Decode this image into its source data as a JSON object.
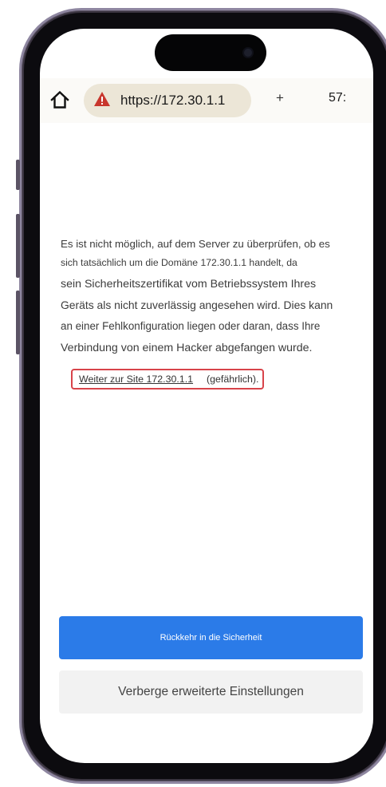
{
  "browser": {
    "url": "https://172.30.1.1",
    "new_tab_label": "+",
    "clock": "57:"
  },
  "warning": {
    "lines": [
      "Es ist nicht möglich, auf dem Server zu überprüfen, ob es",
      "sich tatsächlich um die Domäne 172.30.1.1 handelt, da",
      "sein Sicherheitszertifikat vom Betriebssystem Ihres",
      "Geräts als nicht zuverlässig angesehen wird. Dies kann",
      "an einer Fehlkonfiguration liegen oder daran, dass Ihre",
      "Verbindung von einem Hacker abgefangen wurde."
    ],
    "proceed_link": "Weiter zur Site 172.30.1.1",
    "proceed_suffix": "(gefährlich)."
  },
  "buttons": {
    "back_to_safety": "Rückkehr in die Sicherheit",
    "hide_advanced": "Verberge erweiterte Einstellungen"
  },
  "colors": {
    "primary_button": "#2b7be8",
    "warning_icon": "#c8362d",
    "highlight_box": "#d8434a"
  },
  "icons": {
    "home": "home-icon",
    "warning": "warning-triangle-icon"
  }
}
